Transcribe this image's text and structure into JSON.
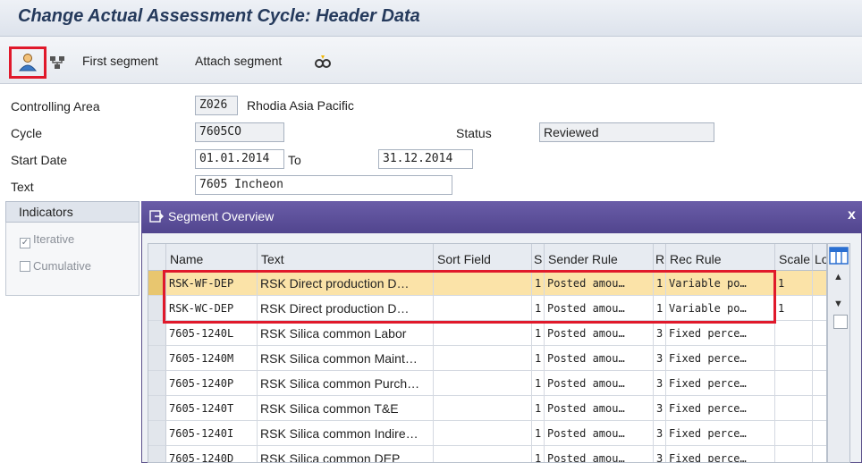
{
  "window": {
    "title": "Change Actual Assessment Cycle: Header Data"
  },
  "toolbar": {
    "first_segment": "First segment",
    "attach_segment": "Attach segment",
    "icons": [
      "person-icon",
      "hierarchy-icon",
      "attach-segment-icon"
    ]
  },
  "form": {
    "controlling_area": {
      "label": "Controlling Area",
      "value": "Z026",
      "description": "Rhodia Asia Pacific"
    },
    "cycle": {
      "label": "Cycle",
      "value": "7605CO"
    },
    "status": {
      "label": "Status",
      "value": "Reviewed"
    },
    "start_date": {
      "label": "Start Date",
      "value": "01.01.2014",
      "to_label": "To",
      "to_value": "31.12.2014"
    },
    "text": {
      "label": "Text",
      "value": "7605 Incheon"
    }
  },
  "indicators": {
    "header": "Indicators",
    "iterative": {
      "label": "Iterative",
      "checked": true
    },
    "cumulative": {
      "label": "Cumulative",
      "checked": false
    }
  },
  "popup": {
    "title": "Segment Overview",
    "close": "x",
    "columns": [
      "Name",
      "Text",
      "Sort Field",
      "S",
      "Sender Rule",
      "R",
      "Rec Rule",
      "Scale",
      "Lo"
    ],
    "rows": [
      {
        "name": "RSK-WF-DEP",
        "text": "RSK Direct production D…",
        "sort": "",
        "s": "1",
        "sender": "Posted amou…",
        "r": "1",
        "rec": "Variable po…",
        "scale": "1"
      },
      {
        "name": "RSK-WC-DEP",
        "text": "RSK Direct production D…",
        "sort": "",
        "s": "1",
        "sender": "Posted amou…",
        "r": "1",
        "rec": "Variable po…",
        "scale": "1"
      },
      {
        "name": "7605-1240L",
        "text": "RSK Silica common Labor",
        "sort": "",
        "s": "1",
        "sender": "Posted amou…",
        "r": "3",
        "rec": "Fixed perce…",
        "scale": ""
      },
      {
        "name": "7605-1240M",
        "text": "RSK Silica common Maint…",
        "sort": "",
        "s": "1",
        "sender": "Posted amou…",
        "r": "3",
        "rec": "Fixed perce…",
        "scale": ""
      },
      {
        "name": "7605-1240P",
        "text": "RSK Silica common Purch…",
        "sort": "",
        "s": "1",
        "sender": "Posted amou…",
        "r": "3",
        "rec": "Fixed perce…",
        "scale": ""
      },
      {
        "name": "7605-1240T",
        "text": "RSK Silica common T&E",
        "sort": "",
        "s": "1",
        "sender": "Posted amou…",
        "r": "3",
        "rec": "Fixed perce…",
        "scale": ""
      },
      {
        "name": "7605-1240I",
        "text": "RSK Silica common Indire…",
        "sort": "",
        "s": "1",
        "sender": "Posted amou…",
        "r": "3",
        "rec": "Fixed perce…",
        "scale": ""
      },
      {
        "name": "7605-1240D",
        "text": "RSK Silica common DEP",
        "sort": "",
        "s": "1",
        "sender": "Posted amou…",
        "r": "3",
        "rec": "Fixed perce…",
        "scale": ""
      }
    ]
  },
  "colors": {
    "highlight": "#e0192b",
    "selected_row": "#fbe3a8",
    "popup_title": "#51458e"
  }
}
